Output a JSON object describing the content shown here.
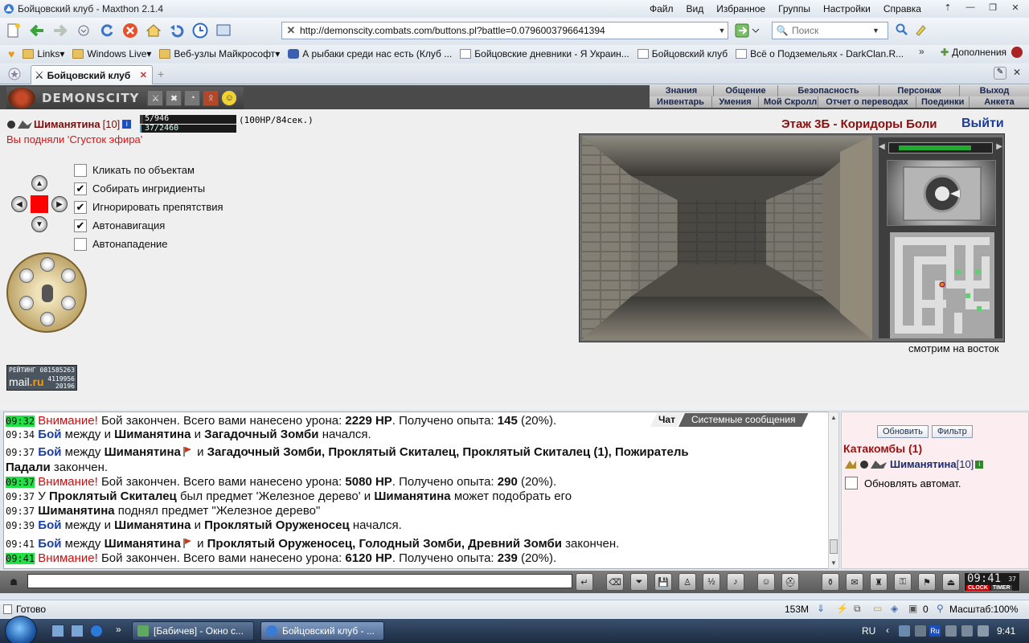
{
  "window": {
    "title": "Бойцовский клуб - Maxthon 2.1.4",
    "menu": [
      "Файл",
      "Вид",
      "Избранное",
      "Группы",
      "Настройки",
      "Справка"
    ]
  },
  "toolbar": {
    "url": "http://demonscity.combats.com/buttons.pl?battle=0.0796003796641394",
    "search_placeholder": "Поиск"
  },
  "favorites": [
    {
      "label": "Links",
      "type": "folder"
    },
    {
      "label": "Windows Live",
      "type": "folder"
    },
    {
      "label": "Веб-узлы Майкрософт",
      "type": "folder"
    },
    {
      "label": "А рыбаки среди нас есть (Клуб ...",
      "type": "car"
    },
    {
      "label": "Бойцовские дневники - Я Украин...",
      "type": "page"
    },
    {
      "label": "Бойцовский клуб",
      "type": "page"
    },
    {
      "label": "Всё о Подземельях - DarkClan.R...",
      "type": "page"
    }
  ],
  "addons_label": "Дополнения",
  "more_label": "»",
  "tab": {
    "label": "Бойцовский клуб"
  },
  "game": {
    "brand": "DEMONSCITY",
    "nav_top": [
      "Знания",
      "Общение",
      "Безопасность",
      "Персонаж",
      "Выход"
    ],
    "nav_bottom": [
      "Инвентарь",
      "Умения",
      "Мой Скролл",
      "Отчет о переводах",
      "Поединки",
      "Анкета"
    ],
    "player": {
      "name": "Шиманятина",
      "level": "[10]",
      "hp_text": "5/946",
      "hp_value": 5,
      "hp_max": 946,
      "mp_text": "37/2460",
      "mp_value": 37,
      "mp_max": 2460,
      "regen": "(100HP/84сек.)"
    },
    "pickup_message": "Вы подняли 'Сгусток эфира'",
    "options": [
      {
        "label": "Кликать по объектам",
        "checked": false
      },
      {
        "label": "Собирать ингридиенты",
        "checked": true
      },
      {
        "label": "Игнорировать препятствия",
        "checked": true
      },
      {
        "label": "Автонавигация",
        "checked": true
      },
      {
        "label": "Автонападение",
        "checked": false
      }
    ],
    "location": "Этаж 3Б - Коридоры Боли",
    "exit_label": "Выйти",
    "facing": "смотрим на восток",
    "rating": {
      "label": "РЕЙТИНГ",
      "line1": "081585263",
      "brand": "mail",
      "brand2": ".ru",
      "line2": "4119956",
      "line3": "20196"
    }
  },
  "chat": {
    "tabs": [
      "Чат",
      "Системные сообщения"
    ],
    "lines": [
      {
        "time": "09:32",
        "hl": true,
        "parts": [
          {
            "t": "Внимание!",
            "c": "red"
          },
          {
            "t": " Бой закончен. Всего вами нанесено урона: "
          },
          {
            "t": "2229 HP",
            "c": "b"
          },
          {
            "t": ". Получено опыта: "
          },
          {
            "t": "145",
            "c": "b"
          },
          {
            "t": " (20%)."
          }
        ]
      },
      {
        "time": "09:34",
        "hl": false,
        "parts": [
          {
            "t": "Бой",
            "c": "blue"
          },
          {
            "t": " между и "
          },
          {
            "t": "Шиманятина",
            "c": "b"
          },
          {
            "t": " и "
          },
          {
            "t": "Загадочный Зомби",
            "c": "b"
          },
          {
            "t": " начался."
          }
        ]
      },
      {
        "time": "09:37",
        "hl": false,
        "parts": [
          {
            "t": "Бой",
            "c": "blue"
          },
          {
            "t": " между "
          },
          {
            "t": "Шиманятина",
            "c": "b"
          },
          {
            "t": "",
            "c": "flag"
          },
          {
            "t": " и "
          },
          {
            "t": "Загадочный Зомби, Проклятый Скиталец, Проклятый Скиталец (1), Пожиратель",
            "c": "b"
          }
        ]
      },
      {
        "time": "",
        "hl": false,
        "parts": [
          {
            "t": "Падали",
            "c": "b"
          },
          {
            "t": " закончен."
          }
        ]
      },
      {
        "time": "09:37",
        "hl": true,
        "parts": [
          {
            "t": "Внимание!",
            "c": "red"
          },
          {
            "t": " Бой закончен. Всего вами нанесено урона: "
          },
          {
            "t": "5080 HP",
            "c": "b"
          },
          {
            "t": ". Получено опыта: "
          },
          {
            "t": "290",
            "c": "b"
          },
          {
            "t": " (20%)."
          }
        ]
      },
      {
        "time": "09:37",
        "hl": false,
        "parts": [
          {
            "t": "У "
          },
          {
            "t": "Проклятый Скиталец",
            "c": "b"
          },
          {
            "t": " был предмет 'Железное дерево' и "
          },
          {
            "t": "Шиманятина",
            "c": "b"
          },
          {
            "t": " может подобрать его"
          }
        ]
      },
      {
        "time": "09:37",
        "hl": false,
        "parts": [
          {
            "t": "Шиманятина",
            "c": "b"
          },
          {
            "t": " поднял предмет \"Железное дерево\""
          }
        ]
      },
      {
        "time": "09:39",
        "hl": false,
        "parts": [
          {
            "t": "Бой",
            "c": "blue"
          },
          {
            "t": " между и "
          },
          {
            "t": "Шиманятина",
            "c": "b"
          },
          {
            "t": " и "
          },
          {
            "t": "Проклятый Оруженосец",
            "c": "b"
          },
          {
            "t": " начался."
          }
        ]
      },
      {
        "time": "09:41",
        "hl": false,
        "parts": [
          {
            "t": "Бой",
            "c": "blue"
          },
          {
            "t": " между "
          },
          {
            "t": "Шиманятина",
            "c": "b"
          },
          {
            "t": "",
            "c": "flag"
          },
          {
            "t": " и "
          },
          {
            "t": "Проклятый Оруженосец, Голодный Зомби, Древний Зомби",
            "c": "b"
          },
          {
            "t": " закончен."
          }
        ]
      },
      {
        "time": "09:41",
        "hl": true,
        "parts": [
          {
            "t": "Внимание!",
            "c": "red"
          },
          {
            "t": " Бой закончен. Всего вами нанесено урона: "
          },
          {
            "t": "6120 HP",
            "c": "b"
          },
          {
            "t": ". Получено опыта: "
          },
          {
            "t": "239",
            "c": "b"
          },
          {
            "t": " (20%)."
          }
        ]
      }
    ]
  },
  "online": {
    "refresh_label": "Обновить",
    "filter_label": "Фильтр",
    "room": "Катакомбы (1)",
    "user_name": "Шиманятина",
    "user_level": "[10]",
    "auto_label": "Обновлять автомат."
  },
  "clock": {
    "time": "09:41",
    "seconds": "37",
    "label1": "CLOCK",
    "label2": "TIMER"
  },
  "statusbar": {
    "status": "Готово",
    "memory": "153M",
    "counter": "0",
    "zoom": "Масштаб:100%"
  },
  "taskbar": {
    "tasks": [
      "[Бабичев] - Окно с...",
      "Бойцовский клуб - ..."
    ],
    "lang": "RU",
    "time": "9:41"
  },
  "colors": {
    "accent_red": "#d10d0d",
    "link_blue": "#1a3fa6",
    "highlight": "#22e045"
  }
}
